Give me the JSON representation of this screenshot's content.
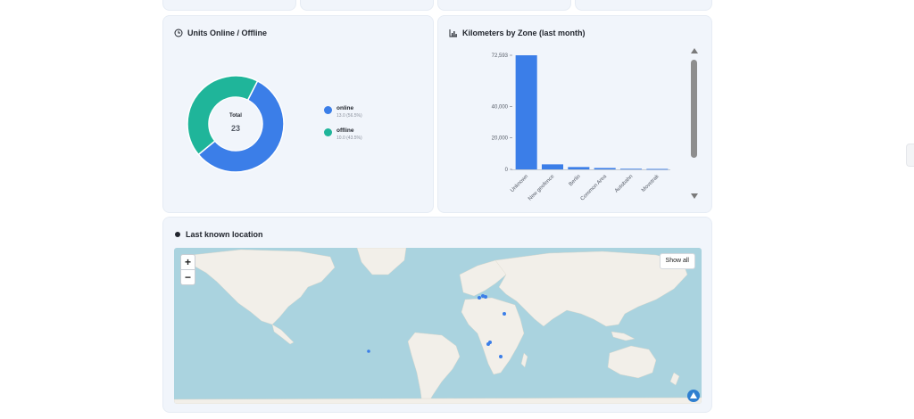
{
  "units_card": {
    "title": "Units Online / Offline",
    "icon": "clock-icon",
    "total_label": "Total",
    "total_value": "23",
    "legend": [
      {
        "name": "online",
        "value_text": "13.0 (56.5%)",
        "value": 13,
        "color": "#3b7ee8"
      },
      {
        "name": "offline",
        "value_text": "10.0 (43.5%)",
        "value": 10,
        "color": "#1fb59a"
      }
    ]
  },
  "km_card": {
    "title": "Kilometers by Zone (last month)",
    "icon": "bar-chart-icon",
    "y_ticks": [
      "72,593",
      "40,000",
      "20,000",
      "0"
    ]
  },
  "chart_data": {
    "type": "bar",
    "title": "Kilometers by Zone (last month)",
    "categories": [
      "Unknown",
      "New geofence",
      "Berlin",
      "Common Area",
      "Autobahn",
      "Movetrak"
    ],
    "values": [
      72593,
      3200,
      1500,
      900,
      400,
      300
    ],
    "ylim": [
      0,
      72593
    ],
    "y_ticks": [
      0,
      20000,
      40000,
      72593
    ],
    "color": "#3b7ee8"
  },
  "location_card": {
    "title": "Last known location",
    "icon": "location-dot-icon",
    "zoom_in": "+",
    "zoom_out": "−",
    "show_all_label": "Show all"
  }
}
